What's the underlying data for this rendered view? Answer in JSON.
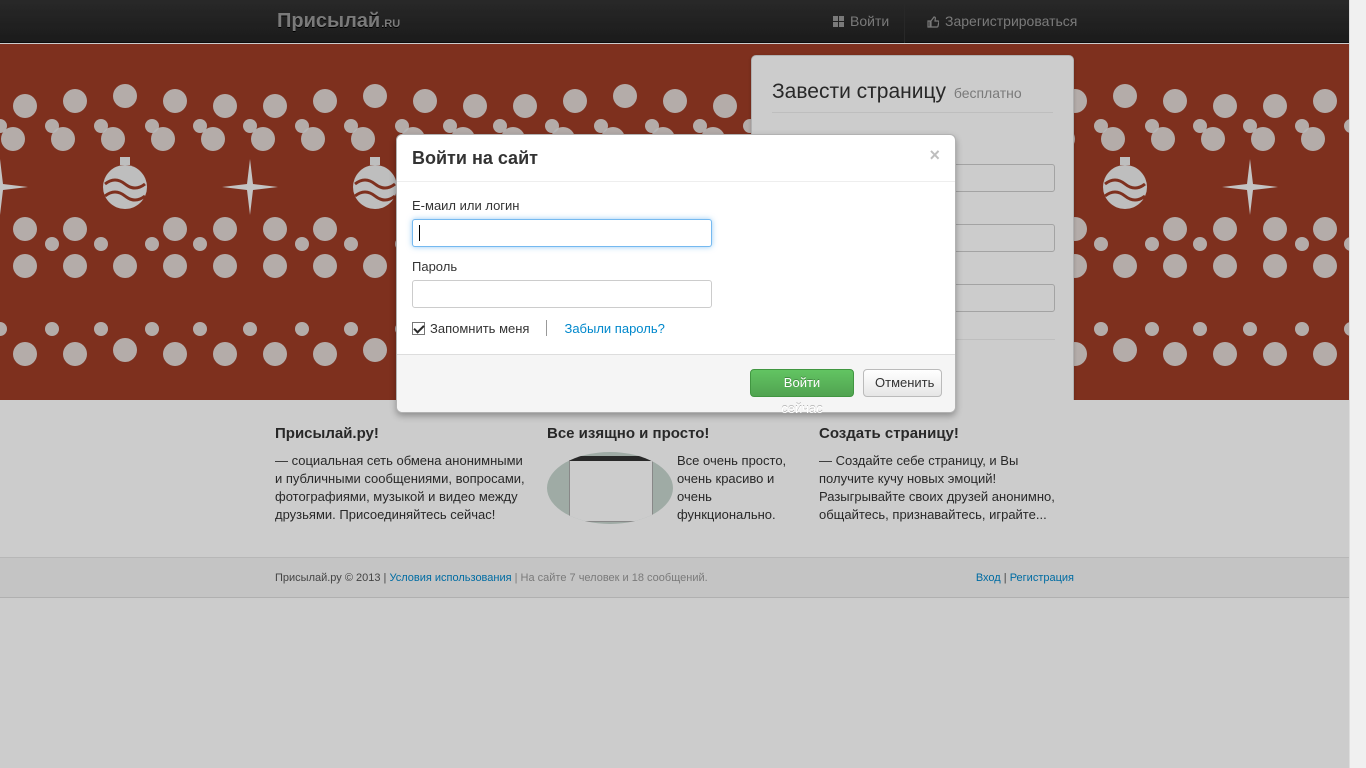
{
  "navbar": {
    "brand": "Присылай",
    "brand_suffix": ".RU",
    "login": "Войти",
    "register": "Зарегистрироваться"
  },
  "signup_panel": {
    "title": "Завести страницу",
    "title_suffix": "бесплатно"
  },
  "info": {
    "col1": {
      "title": "Присылай.ру!",
      "text": "— социальная сеть обмена анонимными и публичными сообщениями, вопросами, фотографиями, музыкой и видео между друзьями. Присоединяйтесь сейчас!"
    },
    "col2": {
      "title": "Все изящно и просто!",
      "text": "Все очень просто, очень красиво и очень функционально."
    },
    "col3": {
      "title": "Создать страницу!",
      "text": "— Создайте себе страницу, и Вы получите кучу новых эмоций! Разыгрывайте своих друзей анонимно, общайтесь, признавайтесь, играйте..."
    }
  },
  "footer": {
    "copyright": "Присылай.ру © 2013 |",
    "terms": "Условия использования",
    "online": "| На сайте 7 человек и 18 сообщений.",
    "login": "Вход",
    "sep": "|",
    "register": "Регистрация"
  },
  "modal": {
    "title": "Войти на сайт",
    "close": "×",
    "email_label": "Е-маил или логин",
    "email_value": "",
    "password_label": "Пароль",
    "password_value": "",
    "remember": "Запомнить меня",
    "remember_checked": true,
    "forgot": "Забыли пароль?",
    "submit": "Войти сейчас",
    "cancel": "Отменить"
  },
  "colors": {
    "hero_bg": "#9e3c26",
    "navbar_bg": "#222222",
    "success": "#51a351",
    "link": "#0088cc"
  }
}
